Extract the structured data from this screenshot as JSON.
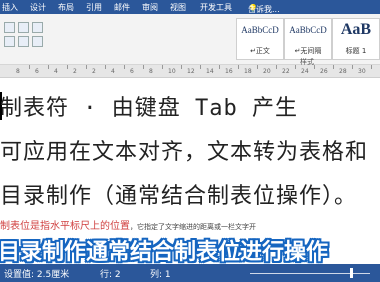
{
  "ribbon": {
    "tabs": [
      "插入",
      "设计",
      "布局",
      "引用",
      "邮件",
      "审阅",
      "视图",
      "开发工具"
    ],
    "help_icon": "lightbulb-icon",
    "help_text": "告诉我..."
  },
  "styles": {
    "items": [
      {
        "preview": "AaBbCcD",
        "name": "↵正文"
      },
      {
        "preview": "AaBbCcD",
        "name": "↵无间隔"
      },
      {
        "preview": "AaB",
        "name": "标题 1"
      }
    ],
    "group_label": "样式"
  },
  "ruler": {
    "numbers": [
      "8",
      "6",
      "4",
      "2",
      "2",
      "4",
      "6",
      "8",
      "10",
      "12",
      "14",
      "16",
      "18",
      "20",
      "22",
      "24",
      "26",
      "28",
      "30"
    ]
  },
  "document": {
    "lines": [
      "制表符 · 由键盘 Tab 产生",
      "可应用在文本对齐，文本转为表格和",
      "目录制作（通常结合制表位操作）。"
    ],
    "red_note": "制表位是指水平标尺上的位置",
    "small_note": "，它指定了文字缩进的距离或一栏文字开"
  },
  "subtitle": "目录制作通常结合制表位进行操作",
  "status": {
    "position": "设置值: 2.5厘米",
    "col": "行: 2",
    "col2": "列: 1"
  },
  "colors": {
    "ribbon": "#2b579a",
    "subtitle_outline": "#1565c0",
    "note": "#d04040"
  }
}
